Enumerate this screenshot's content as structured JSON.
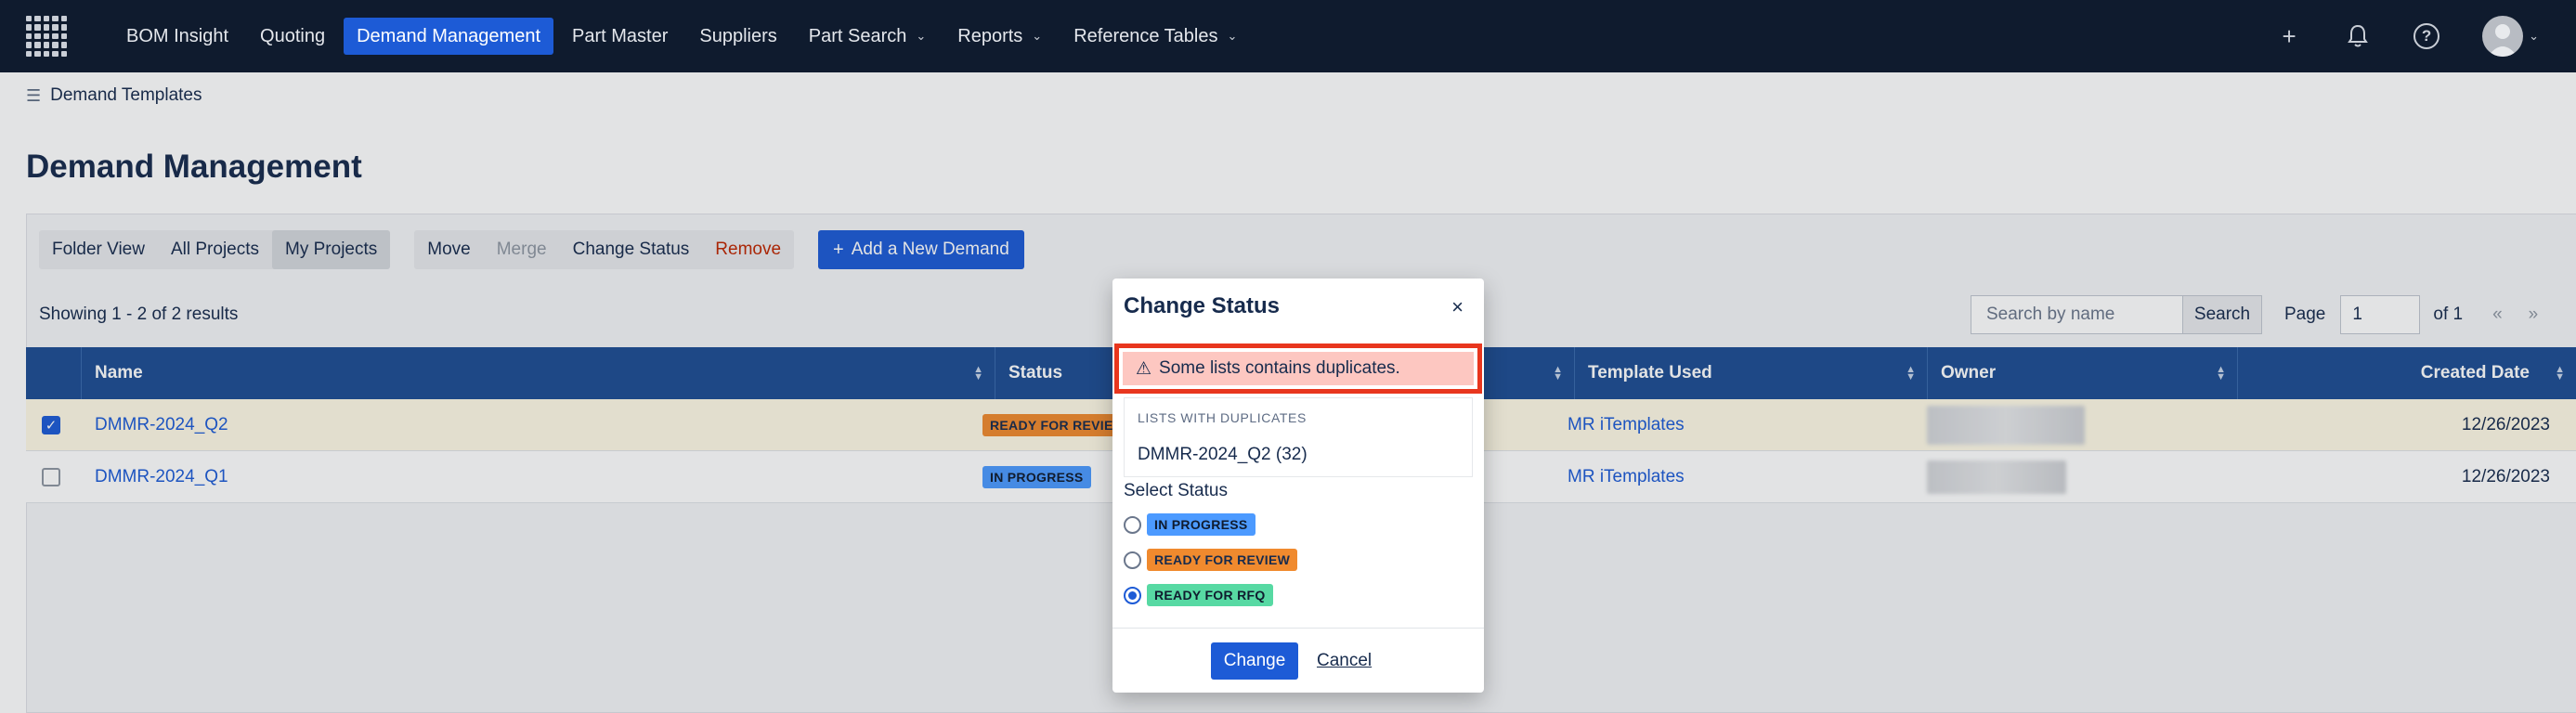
{
  "nav": {
    "items": [
      {
        "label": "BOM Insight",
        "dropdown": false,
        "active": false
      },
      {
        "label": "Quoting",
        "dropdown": false,
        "active": false
      },
      {
        "label": "Demand Management",
        "dropdown": false,
        "active": true
      },
      {
        "label": "Part Master",
        "dropdown": false,
        "active": false
      },
      {
        "label": "Suppliers",
        "dropdown": false,
        "active": false
      },
      {
        "label": "Part Search",
        "dropdown": true,
        "active": false
      },
      {
        "label": "Reports",
        "dropdown": true,
        "active": false
      },
      {
        "label": "Reference Tables",
        "dropdown": true,
        "active": false
      }
    ],
    "icons": [
      "plus-icon",
      "bell-icon",
      "help-icon",
      "avatar"
    ]
  },
  "breadcrumb": {
    "label": "Demand Templates",
    "icon": "list-icon"
  },
  "page_title": "Demand Management",
  "toolbar": {
    "view_group": [
      {
        "label": "Folder View",
        "selected": false
      },
      {
        "label": "All Projects",
        "selected": false
      },
      {
        "label": "My Projects",
        "selected": true
      }
    ],
    "actions": [
      {
        "label": "Move",
        "state": "normal"
      },
      {
        "label": "Merge",
        "state": "disabled"
      },
      {
        "label": "Change Status",
        "state": "normal"
      },
      {
        "label": "Remove",
        "state": "danger"
      }
    ],
    "add_label": "Add a New Demand"
  },
  "results": {
    "showing": "Showing 1 - 2 of 2 results",
    "search_placeholder": "Search by name",
    "search_label": "Search",
    "page_label": "Page",
    "page_value": "1",
    "page_total": "of 1",
    "prev": "«",
    "next": "»"
  },
  "table": {
    "columns": [
      "Name",
      "Status",
      "Template Used",
      "Owner",
      "Created Date"
    ],
    "rows": [
      {
        "name": "DMMR-2024_Q2",
        "status": "READY FOR REVIE",
        "template": "MR iTemplates",
        "created": "12/26/2023",
        "checked": true
      },
      {
        "name": "DMMR-2024_Q1",
        "status": "IN PROGRESS",
        "template": "MR iTemplates",
        "created": "12/26/2023",
        "checked": false
      }
    ]
  },
  "modal": {
    "title": "Change Status",
    "close": "×",
    "alert": "Some lists contains duplicates.",
    "dups_label": "LISTS WITH DUPLICATES",
    "dups_item": "DMMR-2024_Q2 (32)",
    "select_label": "Select Status",
    "options": [
      {
        "label": "IN PROGRESS",
        "color": "#4c9aff",
        "selected": false
      },
      {
        "label": "READY FOR REVIEW",
        "color": "#f08a2e",
        "selected": false
      },
      {
        "label": "READY FOR RFQ",
        "color": "#57d9a3",
        "selected": true
      }
    ],
    "change_label": "Change",
    "cancel_label": "Cancel"
  },
  "colors": {
    "nav_bg": "#0f1b2e",
    "accent": "#1d5bd6",
    "table_header": "#1e4d93",
    "highlight_frame": "#e8361e"
  }
}
